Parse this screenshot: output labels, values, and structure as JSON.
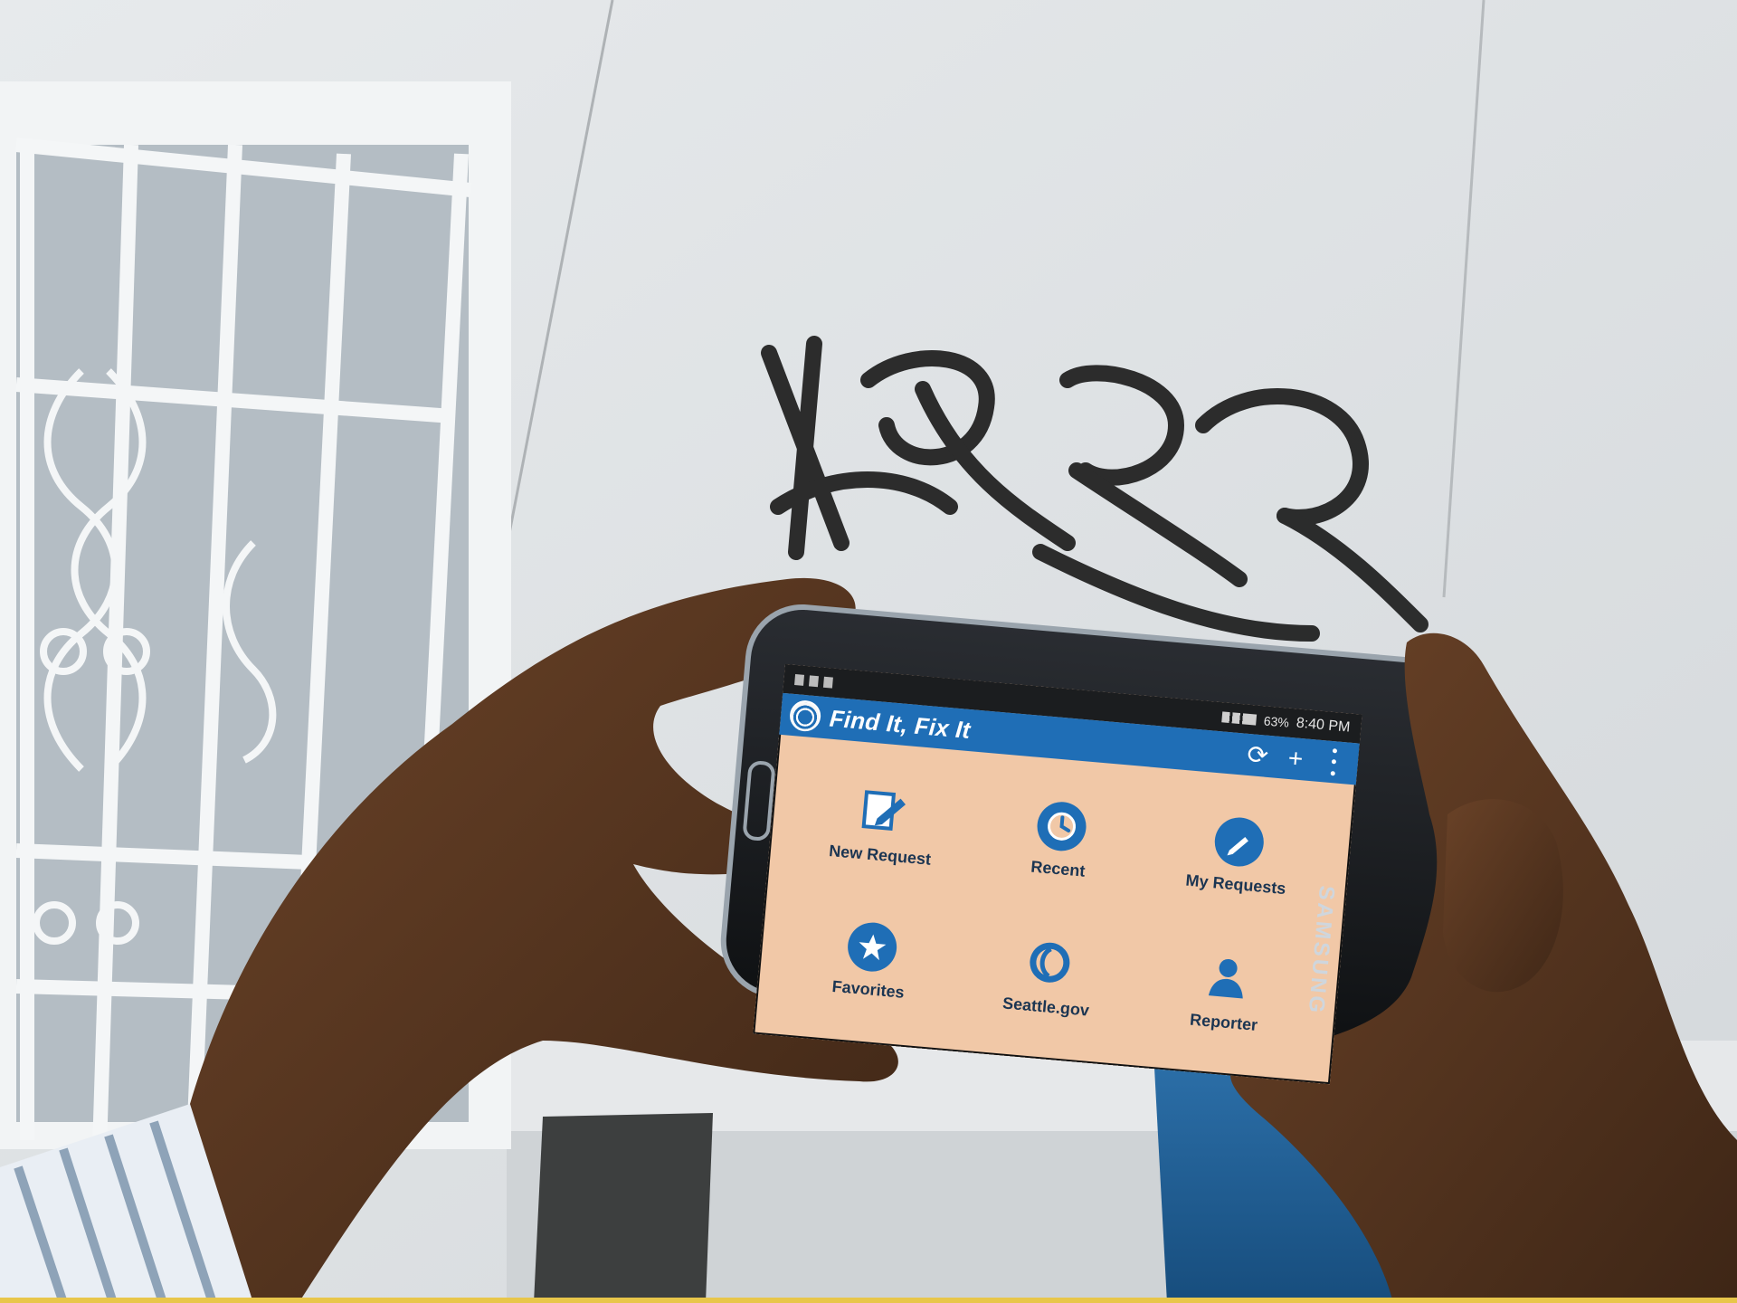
{
  "phone": {
    "status_bar": {
      "battery": "63%",
      "time": "8:40 PM"
    },
    "app_bar": {
      "title": "Find It, Fix It",
      "actions": [
        {
          "icon": "refresh-icon"
        },
        {
          "icon": "add-icon"
        },
        {
          "icon": "overflow-menu-icon"
        }
      ]
    },
    "tiles": [
      {
        "label": "New Request",
        "icon": "new-request-icon"
      },
      {
        "label": "Recent",
        "icon": "clock-icon"
      },
      {
        "label": "My Requests",
        "icon": "pencil-icon"
      },
      {
        "label": "Favorites",
        "icon": "star-icon"
      },
      {
        "label": "Seattle.gov",
        "icon": "seattle-logo-icon"
      },
      {
        "label": "Reporter",
        "icon": "person-icon"
      }
    ],
    "device_brand": "SAMSUNG"
  },
  "colors": {
    "app_bar": "#1f6eb6",
    "screen_background": "#f1c8a7",
    "icon_blue": "#1f6eb6",
    "label_text": "#1b3552"
  }
}
